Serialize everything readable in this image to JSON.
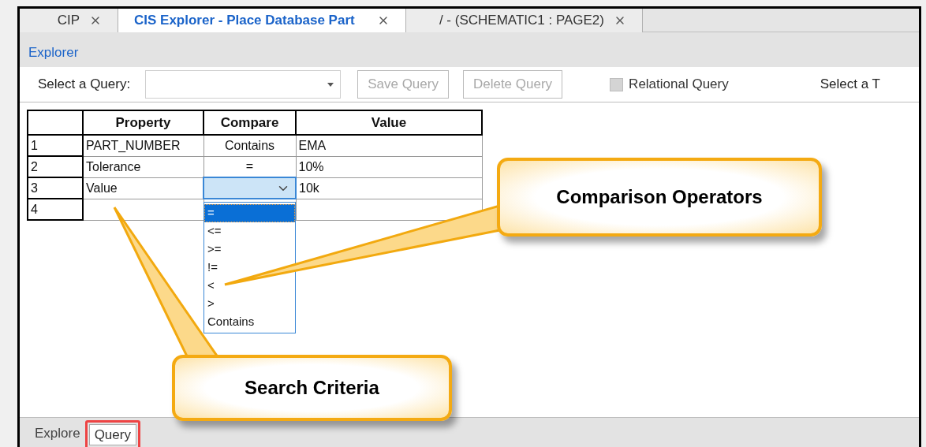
{
  "tabs": [
    {
      "label": "CIP",
      "selected": false
    },
    {
      "label": "CIS Explorer - Place Database Part",
      "selected": true
    },
    {
      "label": "/ - (SCHEMATIC1 : PAGE2)",
      "selected": false
    }
  ],
  "panel_title": "Explorer",
  "toolbar": {
    "query_label": "Select a Query:",
    "buttons": [
      {
        "label": "Save Query",
        "disabled": true
      },
      {
        "label": "Delete Query",
        "disabled": true
      }
    ],
    "relational": {
      "label": "Relational Query",
      "checked": false,
      "disabled": true
    },
    "table_label": "Select a T"
  },
  "table": {
    "columns": [
      "Property",
      "Compare",
      "Value"
    ],
    "rows": [
      {
        "number": "1",
        "property": "PART_NUMBER",
        "compare": "Contains",
        "value": "EMA",
        "editing": false
      },
      {
        "number": "2",
        "property": "Tolerance",
        "compare": "=",
        "value": "10%",
        "editing": false
      },
      {
        "number": "3",
        "property": "Value",
        "value": "10k",
        "editing": true
      },
      {
        "number": "4",
        "editing": false
      }
    ]
  },
  "compare_options": [
    {
      "label": "=",
      "selected": true
    },
    {
      "label": "<=",
      "selected": false
    },
    {
      "label": ">=",
      "selected": false
    },
    {
      "label": "!=",
      "selected": false
    },
    {
      "label": "<",
      "selected": false
    },
    {
      "label": ">",
      "selected": false
    },
    {
      "label": "Contains",
      "selected": false
    }
  ],
  "callouts": [
    {
      "text": "Comparison Operators"
    },
    {
      "text": "Search Criteria"
    }
  ],
  "bottom_tabs": [
    {
      "label": "Explore",
      "selected": false,
      "highlighted": false
    },
    {
      "label": "Query",
      "selected": true,
      "highlighted": true
    }
  ]
}
